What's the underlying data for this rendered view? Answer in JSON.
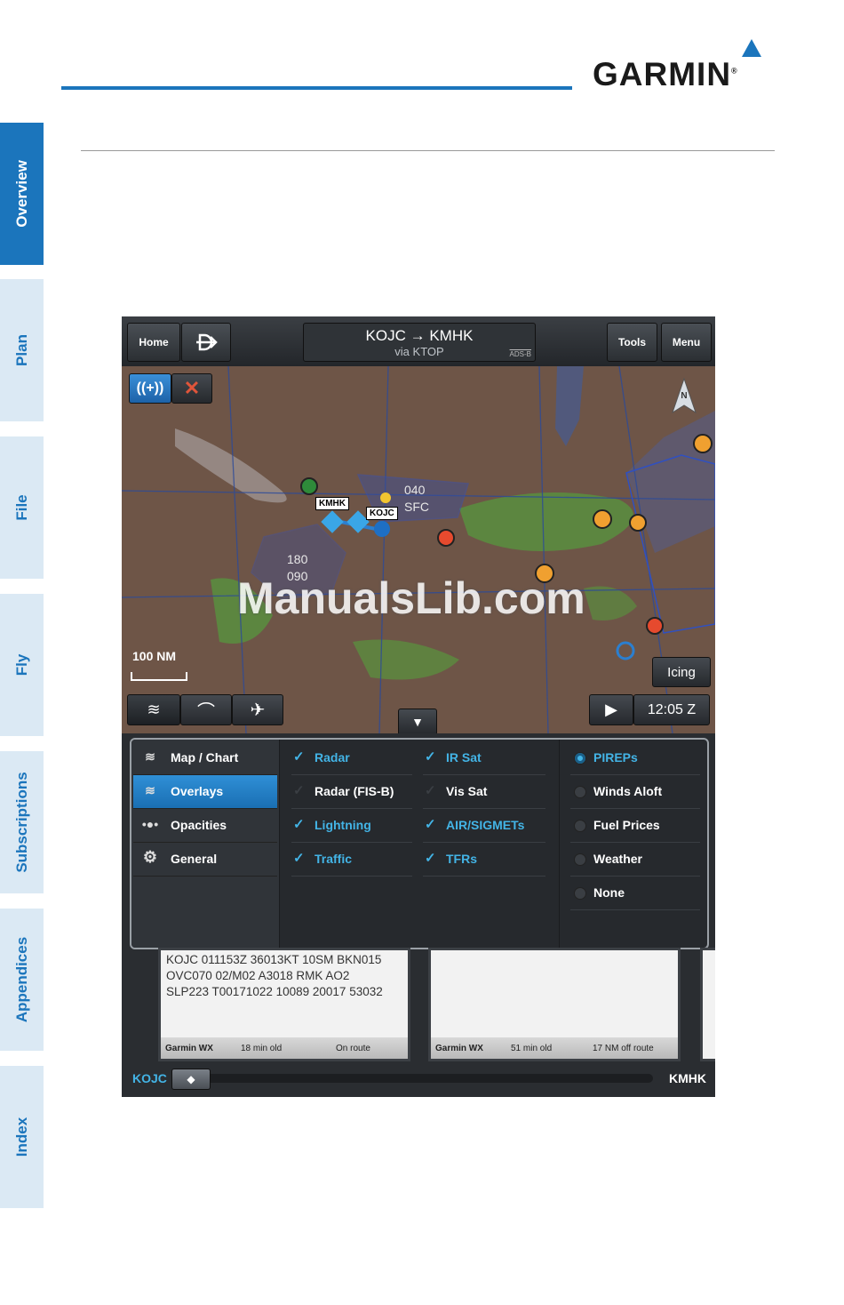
{
  "header": {
    "logo_text": "GARMIN",
    "logo_mark": "®"
  },
  "side_tabs": [
    "Overview",
    "Plan",
    "File",
    "Fly",
    "Subscriptions",
    "Appendices",
    "Index"
  ],
  "app": {
    "top_bar": {
      "home_label": "Home",
      "direct_to_icon": "direct-to-icon",
      "route_title": "KOJC → KMHK",
      "route_via": "via KTOP",
      "adsb_label": "ADS-B",
      "tools_label": "Tools",
      "menu_label": "Menu"
    },
    "map": {
      "airspace_labels": [
        {
          "top": "040",
          "bottom": "SFC"
        },
        {
          "top": "180",
          "bottom": "090"
        }
      ],
      "airport_labels": [
        "KMHK",
        "KOJC"
      ],
      "scale_label": "100 NM",
      "icing_label": "Icing",
      "time_label": "12:05 Z",
      "watermark": "ManualsLib.com"
    },
    "overlay_panel": {
      "menu": [
        {
          "label": "Map / Chart",
          "icon": "layers-icon",
          "selected": false
        },
        {
          "label": "Overlays",
          "icon": "layers-icon",
          "selected": true
        },
        {
          "label": "Opacities",
          "icon": "slider-icon",
          "selected": false
        },
        {
          "label": "General",
          "icon": "gear-icon",
          "selected": false
        }
      ],
      "overlays_col1": [
        {
          "label": "Radar",
          "checked": true
        },
        {
          "label": "Radar (FIS-B)",
          "checked": false
        },
        {
          "label": "Lightning",
          "checked": true
        },
        {
          "label": "Traffic",
          "checked": true
        }
      ],
      "overlays_col2": [
        {
          "label": "IR Sat",
          "checked": true
        },
        {
          "label": "Vis Sat",
          "checked": false
        },
        {
          "label": "AIR/SIGMETs",
          "checked": true
        },
        {
          "label": "TFRs",
          "checked": true
        }
      ],
      "radio_options": [
        {
          "label": "PIREPs",
          "selected": true
        },
        {
          "label": "Winds Aloft",
          "selected": false
        },
        {
          "label": "Fuel Prices",
          "selected": false
        },
        {
          "label": "Weather",
          "selected": false
        },
        {
          "label": "None",
          "selected": false
        }
      ]
    },
    "cards": [
      {
        "text": "KOJC 011153Z 36013KT 10SM BKN015\nOVC070 02/M02 A3018 RMK AO2\nSLP223 T00171022 10089 20017 53032",
        "source": "Garmin WX",
        "age": "18 min old",
        "position": "On route"
      },
      {
        "text": "",
        "source": "Garmin WX",
        "age": "51 min old",
        "position": "17 NM off route"
      }
    ],
    "route_bar": {
      "from": "KOJC",
      "to": "KMHK"
    }
  },
  "colors": {
    "brand_blue": "#1b75bc",
    "accent_cyan": "#43b4e6",
    "selected_blue": "#1a6fb3"
  }
}
